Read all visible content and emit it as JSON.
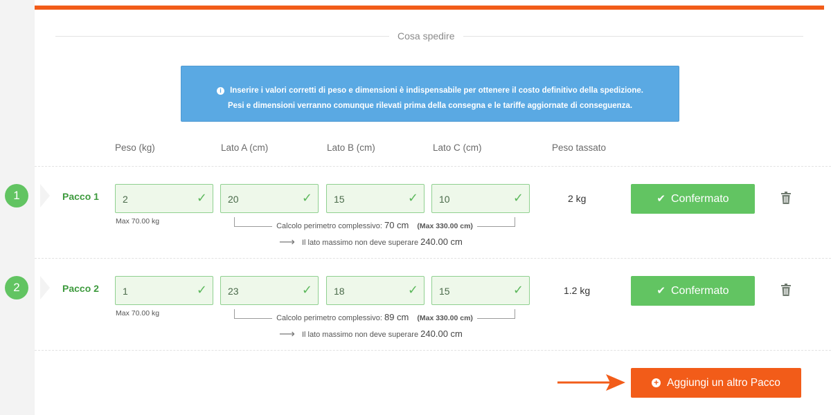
{
  "section": {
    "title": "Cosa spedire"
  },
  "info": {
    "icon": "info-circle-icon",
    "line1": "Inserire i valori corretti di peso e dimensioni è indispensabile per ottenere il costo definitivo della spedizione.",
    "line2": "Pesi e dimensioni verranno comunque rilevati prima della consegna e le tariffe aggiornate di conseguenza."
  },
  "columns": {
    "peso": "Peso (kg)",
    "lato_a": "Lato A (cm)",
    "lato_b": "Lato B (cm)",
    "lato_c": "Lato C (cm)",
    "peso_tassato": "Peso tassato"
  },
  "packages": [
    {
      "step": "1",
      "label": "Pacco 1",
      "peso": "2",
      "lato_a": "20",
      "lato_b": "15",
      "lato_c": "10",
      "max_peso": "Max 70.00 kg",
      "perimeter_text": "Calcolo perimetro complessivo:",
      "perimeter_value": "70 cm",
      "perimeter_max": "(Max 330.00 cm)",
      "lato_note": "Il lato massimo non deve superare",
      "lato_max": "240.00 cm",
      "peso_tassato": "2 kg",
      "button": "Confermato"
    },
    {
      "step": "2",
      "label": "Pacco 2",
      "peso": "1",
      "lato_a": "23",
      "lato_b": "18",
      "lato_c": "15",
      "max_peso": "Max 70.00 kg",
      "perimeter_text": "Calcolo perimetro complessivo:",
      "perimeter_value": "89 cm",
      "perimeter_max": "(Max 330.00 cm)",
      "lato_note": "Il lato massimo non deve superare",
      "lato_max": "240.00 cm",
      "peso_tassato": "1.2 kg",
      "button": "Confermato"
    }
  ],
  "actions": {
    "add_package": "Aggiungi un altro Pacco"
  },
  "colors": {
    "accent": "#f25c19",
    "success": "#62c462",
    "info": "#5aa9e3"
  }
}
